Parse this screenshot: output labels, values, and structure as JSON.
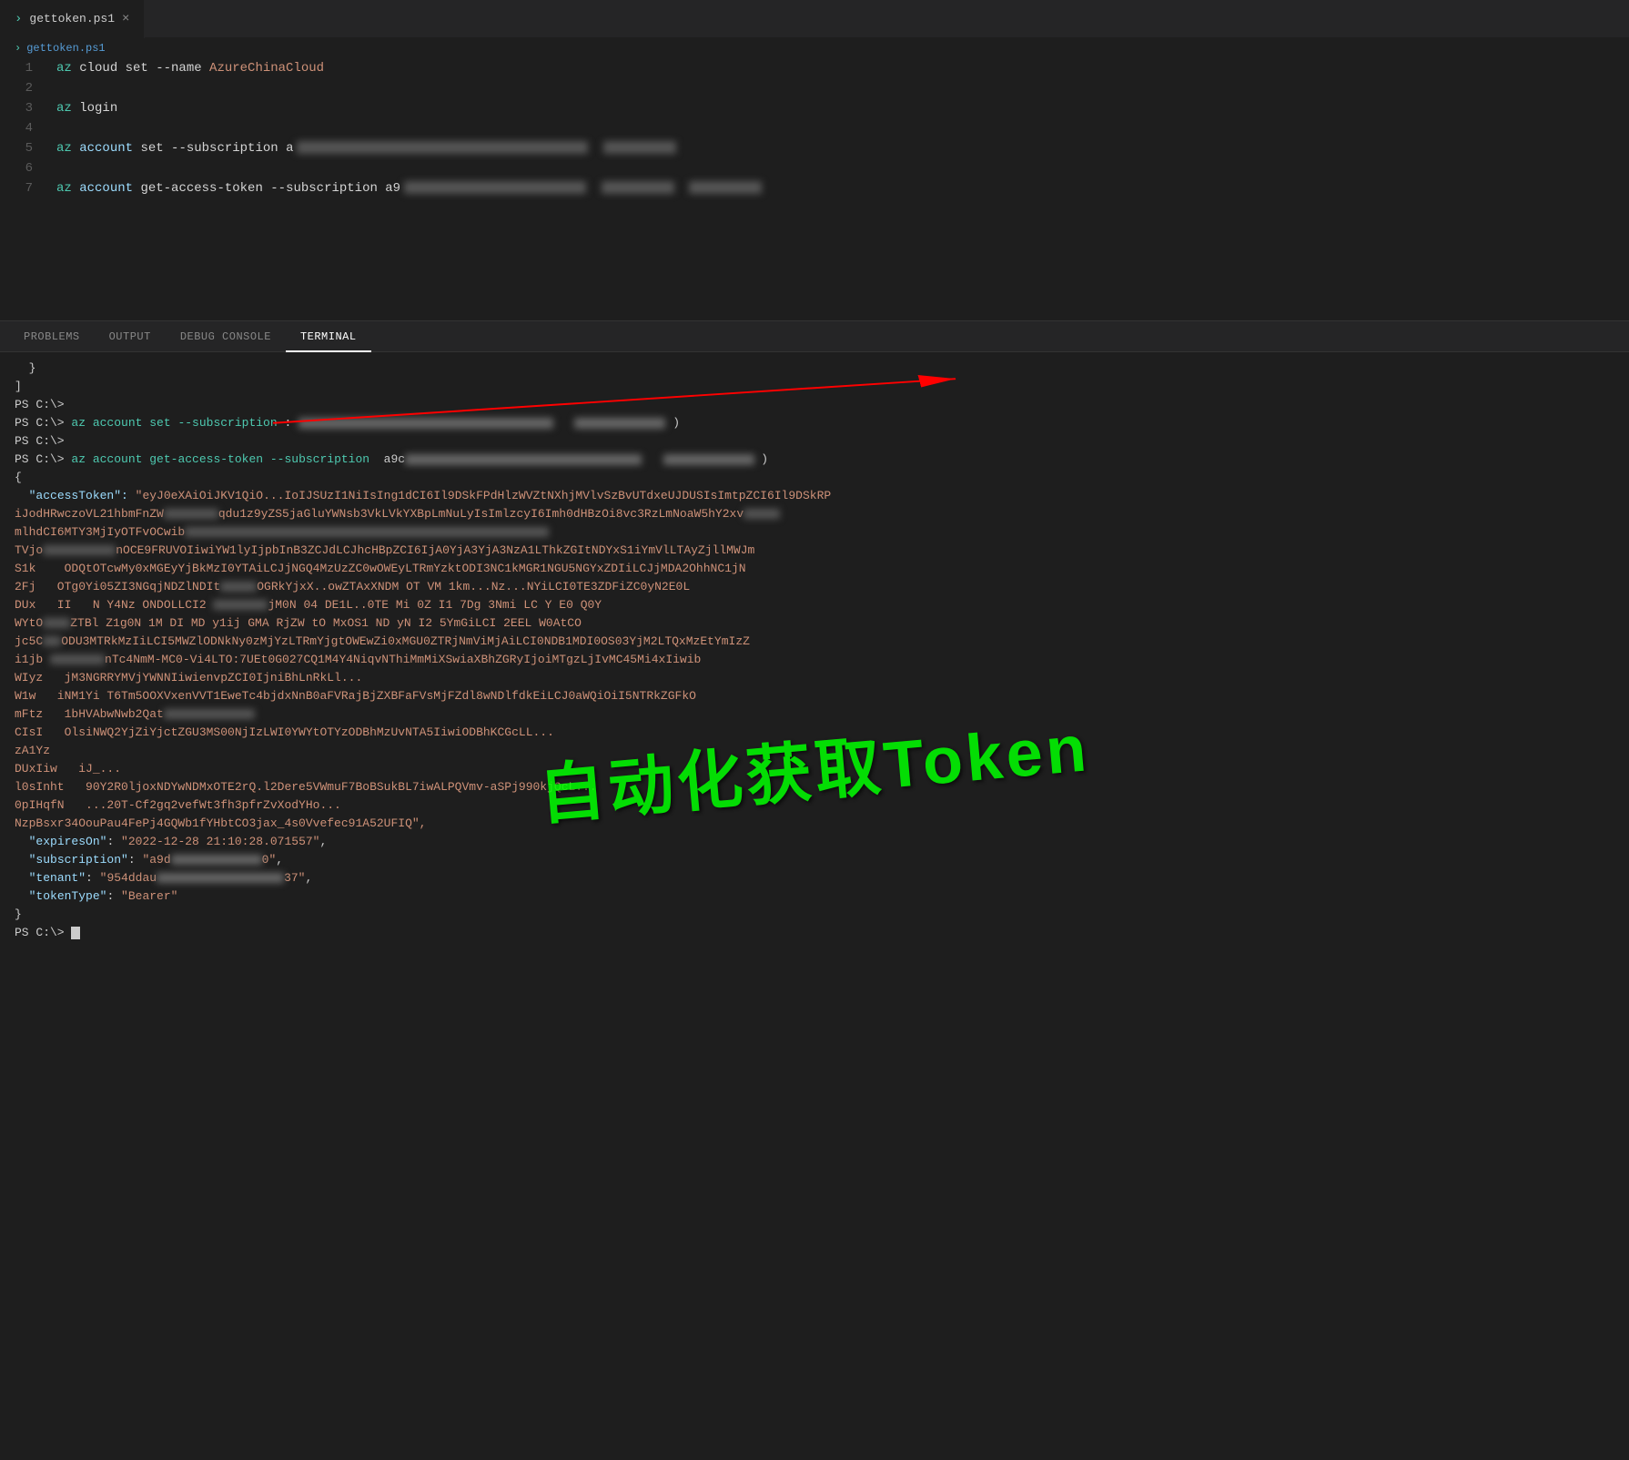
{
  "tabBar": {
    "tab1": {
      "label": "gettoken.ps1",
      "icon": "›",
      "close": "×"
    }
  },
  "breadcrumb": {
    "icon": "›",
    "label": "gettoken.ps1"
  },
  "editor": {
    "lines": [
      {
        "num": 1,
        "code": "az cloud set --name AzureChinaCloud",
        "tokens": [
          {
            "type": "cmd",
            "text": "az"
          },
          {
            "type": "plain",
            "text": " cloud set --name "
          },
          {
            "type": "str",
            "text": "AzureChinaCloud"
          }
        ]
      },
      {
        "num": 2,
        "code": "",
        "tokens": []
      },
      {
        "num": 3,
        "code": "az login",
        "tokens": [
          {
            "type": "cmd",
            "text": "az"
          },
          {
            "type": "plain",
            "text": " login"
          }
        ]
      },
      {
        "num": 4,
        "code": "",
        "tokens": []
      },
      {
        "num": 5,
        "code": "az account set --subscription a9...",
        "tokens": [
          {
            "type": "cmd",
            "text": "az"
          },
          {
            "type": "plain",
            "text": " account set --subscription "
          },
          {
            "type": "redacted",
            "text": "REDACTED"
          }
        ]
      },
      {
        "num": 6,
        "code": "",
        "tokens": []
      },
      {
        "num": 7,
        "code": "az account get-access-token --subscription a9...",
        "tokens": [
          {
            "type": "cmd",
            "text": "az"
          },
          {
            "type": "plain",
            "text": " account get-access-token --subscription "
          },
          {
            "type": "redacted",
            "text": "REDACTED"
          }
        ]
      }
    ]
  },
  "panel": {
    "tabs": [
      "PROBLEMS",
      "OUTPUT",
      "DEBUG CONSOLE",
      "TERMINAL"
    ],
    "activeTab": "TERMINAL"
  },
  "terminal": {
    "lines": [
      "  }",
      "]",
      "PS C:\\>",
      "PS C:\\> az account set --subscription : [REDACTED]  )",
      "PS C:\\>",
      "PS C:\\> az account get-access-token --subscription  a9c[REDACTED]  )",
      "{",
      "  \"accessToken\": \"eyJ0eXAiOiJKV1QiO...IoIJSUzI1NiIsIng1dCI6Il9DSkFPdHlzWVZtNXhjMVlvSzBvUTdxeUJDUSIsImtpZCI6Il9DSkRP",
      "iJodHRwczoVL21hbmFnZW...qdu1z9yZS5jaGluYWNsb3VkLVkYXBpLmNuLyIsImlzcyI6Imh0dHBzOi8vc3RzLmNoaW5hY2xv...",
      "mlhdCI6MTY3MjIyOTFvOCwib...",
      "TVjo...nOCE9FRUVOIiwiYW1lyIjpbInB3ZCJdLCJhcHBpZCI6IjA0YjA3YjA3NzA1LThkZGItNDYxS1iYmVlLTAyZjllMWJm",
      "S1k   ODQtOTcwMy0xMGEyYjBkMzI0YTAiLCJjNGQ4MzUzZC0wOWEyLTRmYzktODI3NC1kMGR1NGU5NGYxZDIiLCJjMDA2OhhNC1jN",
      "2Fj  OTg0Yi05ZI3NGqjNDZlNDIt...OGRkYjxX..owZTAxXNDM OT VM  1km...Nz...NYiLCI0TE3ZDFiZC0yN2E0L",
      "DUx  II  N Y4Nz ONDOLLCI2 ...jM0N  04 DE1L..0TE Mi 0Z  I1  7Dg 3Nmi  LC Y E0  Q0Y",
      "WYtO  ZTBl Z1g0N  1M  DI  MD  y1ij GMA  RjZW tO MxOS1 ND yN  I2   5YmGiLCI  2EEL  W0AtCO",
      "jc5C  ODU3MTRkMzIiLCI5MWZlODNkNy0zMjYzLTRmYjgtOWEwZi0xMGU0ZTRjNmViMjAiLCI0NDB1MDI0OS03YjM2LTQxMzEtYmIzZ",
      "i1jb  ...nTc4NmM-MC0-Vi4LTO:7UEt0G027CQ1M4Y4NiqvNThiMmMiXSwiaXBhZGRyIjoiMTgzLjIvMC45Mi4xIiwib",
      "WIyz  jM3NGRRYMVjYWNNIiwienvpZCI0IjniBhLnRkLl...",
      "W1w  iNM1Yi T6Tm5OOXVxenVVT1EweTc4bjdxNnB0aFVRajBjZXBFaFVsMjFZdl8wNDlfdkEiLCJ0aWQiOiI5NTRkZGFkO",
      "mFtz  1bHVAbwNwb2Qat...",
      "CIsI  OlsiNWQ2YjZiYjctZGU3MS00NjIzLWI0YWYtOTYzODBhMzUvNTA5IiwiODBhKCGcLL...",
      "zA1Yz",
      "DUxIiw  iJ_...",
      "l0sInht  90Y2R0ljoxNDYwNDMxOTE2rQ.l2Dere5VWmuF7BoBSukBL7iwALPQVmv-aSPj990kjQcL...",
      "0pIHqfN  ...20T-Cf2gq2vefWt3fh3pfrZvXodYHo...",
      "NzpBsxr34OouPau4FePj4GQWb1fYHbtCO3jax_4s0Vvefec91A52UFIQ\",",
      "  \"expiresOn\": \"2022-12-28 21:10:28.071557\",",
      "  \"subscription\": \"a9d[REDACTED]0\",",
      "  \"tenant\": \"954ddau[REDACTED]37\",",
      "  \"tokenType\": \"Bearer\"",
      "}",
      "PS C:\\>"
    ]
  },
  "overlay": {
    "text": "自动化获取Token"
  }
}
